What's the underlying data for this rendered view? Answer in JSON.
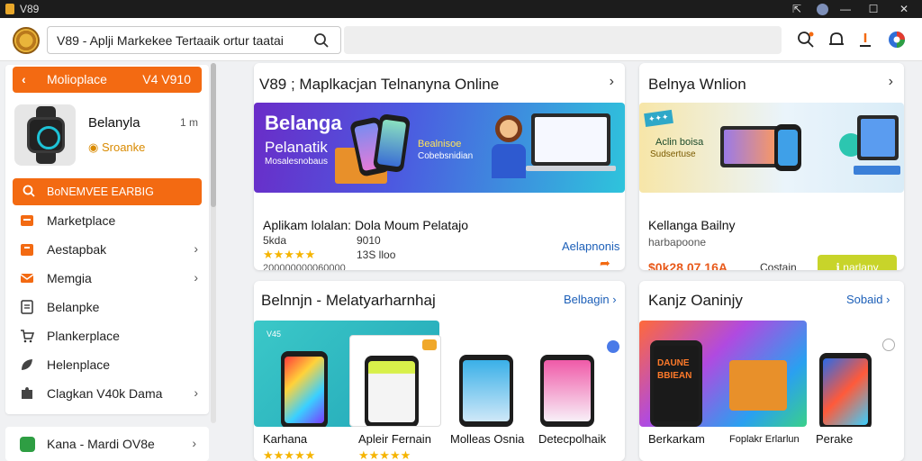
{
  "window": {
    "title": "V89"
  },
  "search": {
    "value": "V89 - Aplji Markekee Tertaaik ortur taatai"
  },
  "sidebar": {
    "header": {
      "label": "Molioplace",
      "value": "V4 V910"
    },
    "profile": {
      "name": "Belanyla",
      "status": "Sroanke",
      "count": "1 m"
    },
    "active": {
      "label": "BoNEMVEE EARBIG"
    },
    "items": [
      {
        "label": "Marketplace",
        "icon": "marketplace-icon",
        "chevron": false
      },
      {
        "label": "Aestapbak",
        "icon": "app-icon",
        "chevron": true
      },
      {
        "label": "Memgia",
        "icon": "mail-icon",
        "chevron": true
      },
      {
        "label": "Belanpke",
        "icon": "document-icon",
        "chevron": false
      },
      {
        "label": "Plankerplace",
        "icon": "cart-icon",
        "chevron": false
      },
      {
        "label": "Helenplace",
        "icon": "leaf-icon",
        "chevron": false
      },
      {
        "label": "Clagkan V40k Dama",
        "icon": "puzzle-icon",
        "chevron": true
      }
    ],
    "bottom": {
      "label": "Kana - Mardi OV8e"
    }
  },
  "cards": {
    "main": {
      "title": "V89 ; Maplkacjan Telnanyna Online",
      "banner_big": "Belanga",
      "banner_sub1": "Pelanatik",
      "banner_sub2": "Mosalesnobaus",
      "banner_mid1": "Bealnisoe",
      "banner_mid2": "Cobebsnidian",
      "product_title": "Aplikam lolalan: Dola Moum Pelatajo",
      "line1": "5kda",
      "line2": "9010",
      "stars": "★★★★★",
      "rating": "13S lloo",
      "meta": "200000000060000",
      "link": "Aelapnonis"
    },
    "side": {
      "title": "Belnya Wnlion",
      "banner_a": "Aclin boisa",
      "banner_b": "Sudsertuse",
      "product_title": "Kellanga Bailny",
      "subtitle": "harbapoone",
      "price": "$0k28 07.16A",
      "status": "Costain",
      "button": "ℹ narlany"
    },
    "grid1": {
      "title": "Belnnjn - Melatyarharnhaj",
      "link": "Belbagin",
      "badge_text": "V45",
      "items": [
        "Karhana",
        "Apleir Fernain",
        "Molleas Osnia",
        "Detecpolhaik"
      ],
      "stars": "★★★★★"
    },
    "grid2": {
      "title": "Kanjz Oaninjy",
      "link": "Sobaid",
      "promo_title": "DAUNE",
      "promo_sub": "BBIEAN",
      "items": [
        "Berkarkam",
        "Foplakr Erlarlun",
        "Perake"
      ]
    }
  },
  "colors": {
    "accent": "#f36a12",
    "link": "#1c5fb8",
    "star": "#f5b400",
    "button": "#c8d42a"
  }
}
